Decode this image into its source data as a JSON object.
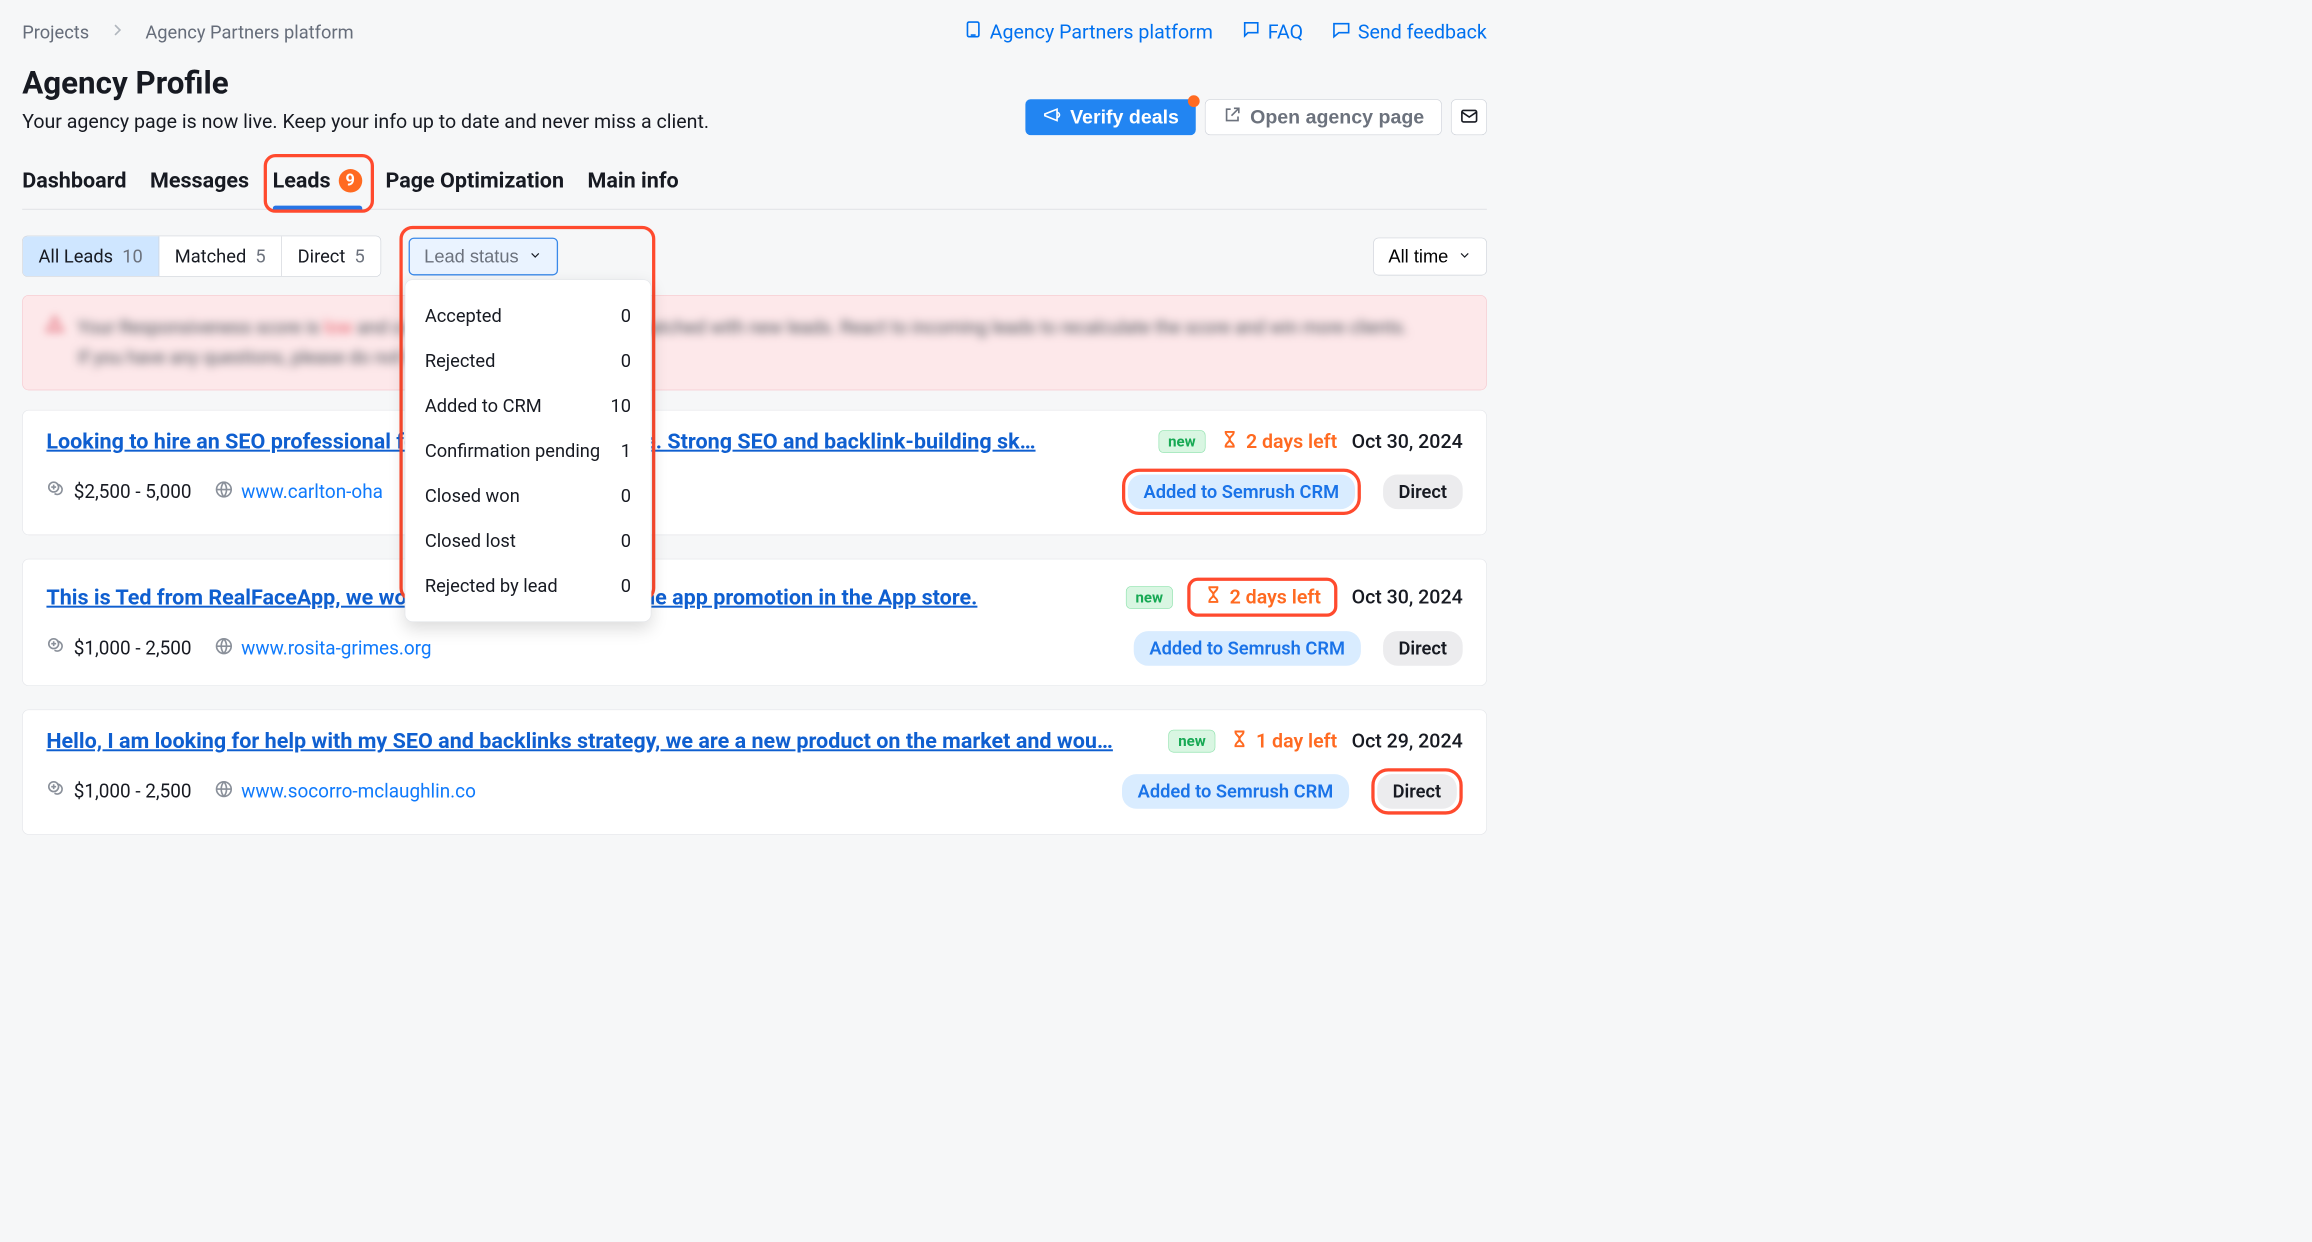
{
  "breadcrumb": {
    "root": "Projects",
    "current": "Agency Partners platform"
  },
  "topLinks": {
    "platform": "Agency Partners platform",
    "faq": "FAQ",
    "feedback": "Send feedback"
  },
  "title": "Agency Profile",
  "subtitle": "Your agency page is now live. Keep your info up to date and never miss a client.",
  "actions": {
    "verify": "Verify deals",
    "open": "Open agency page"
  },
  "tabs": {
    "dashboard": "Dashboard",
    "messages": "Messages",
    "leads": "Leads",
    "leadsBadge": "9",
    "pageOpt": "Page Optimization",
    "mainInfo": "Main info"
  },
  "filters": {
    "all": {
      "label": "All Leads",
      "count": "10"
    },
    "matched": {
      "label": "Matched",
      "count": "5"
    },
    "direct": {
      "label": "Direct",
      "count": "5"
    },
    "status": {
      "label": "Lead status"
    },
    "timeRange": "All time"
  },
  "statusMenu": [
    {
      "label": "Accepted",
      "count": "0"
    },
    {
      "label": "Rejected",
      "count": "0"
    },
    {
      "label": "Added to CRM",
      "count": "10"
    },
    {
      "label": "Confirmation pending",
      "count": "1"
    },
    {
      "label": "Closed won",
      "count": "0"
    },
    {
      "label": "Closed lost",
      "count": "0"
    },
    {
      "label": "Rejected by lead",
      "count": "0"
    }
  ],
  "leads": [
    {
      "title": "Looking to hire an SEO professional for a Shopify-style website. Strong SEO and backlink-building sk…",
      "newBadge": "new",
      "deadline": "2 days left",
      "date": "Oct 30, 2024",
      "budget": "$2,500 - 5,000",
      "site": "www.carlton-oha",
      "crm": "Added to Semrush CRM",
      "source": "Direct",
      "highlightCrm": true,
      "highlightSource": false,
      "highlightDeadline": false
    },
    {
      "title": "This is Ted from RealFaceApp, we would like to get help with the app promotion in the App store.",
      "newBadge": "new",
      "deadline": "2 days left",
      "date": "Oct 30, 2024",
      "budget": "$1,000 - 2,500",
      "site": "www.rosita-grimes.org",
      "crm": "Added to Semrush CRM",
      "source": "Direct",
      "highlightCrm": false,
      "highlightSource": false,
      "highlightDeadline": true
    },
    {
      "title": "Hello, I am looking for help with my SEO and backlinks strategy, we are a new product on the market and wou…",
      "newBadge": "new",
      "deadline": "1 day left",
      "date": "Oct 29, 2024",
      "budget": "$1,000 - 2,500",
      "site": "www.socorro-mclaughlin.co",
      "crm": "Added to Semrush CRM",
      "source": "Direct",
      "highlightCrm": false,
      "highlightSource": true,
      "highlightDeadline": false
    }
  ],
  "banner": {
    "line1a": "Your  Responsiveness  score  is ",
    "line1red": "low",
    "line1b": " and could be affecting how you're matched with new leads. React to incoming leads to recalculate the score and win more clients.",
    "line2a": "If you have any questions, please do ",
    "line2b": "not hesitate to ",
    "line2link": "ask here"
  }
}
